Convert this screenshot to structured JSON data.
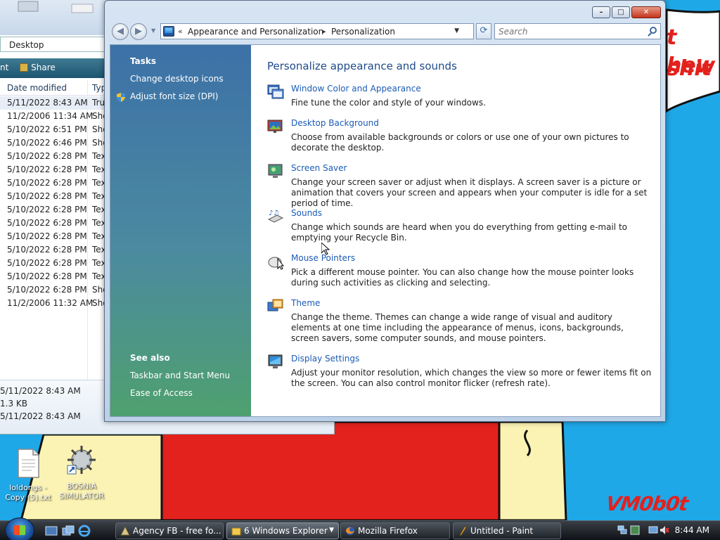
{
  "desktop": {
    "icons": [
      {
        "label": "loldongs - Copy (5).txt",
        "name": "text-file-icon"
      },
      {
        "label": "BOSNIA SIMULATOR",
        "name": "bosnia-simulator-icon"
      }
    ],
    "paint_text_line1": "t shit",
    "paint_text_line2": "hew",
    "watermark": "VM0b0t"
  },
  "explorer_back": {
    "address": "Desktop",
    "toolbar_left": "nt",
    "toolbar_share": "Share",
    "col_date": "Date modified",
    "col_type": "Typ",
    "rows": [
      {
        "date": "5/11/2022 8:43 AM",
        "type": "Tru"
      },
      {
        "date": "11/2/2006 11:34 AM",
        "type": "Sho"
      },
      {
        "date": "5/10/2022 6:51 PM",
        "type": "Sho"
      },
      {
        "date": "5/10/2022 6:46 PM",
        "type": "Sho"
      },
      {
        "date": "5/10/2022 6:28 PM",
        "type": "Tex"
      },
      {
        "date": "5/10/2022 6:28 PM",
        "type": "Tex"
      },
      {
        "date": "5/10/2022 6:28 PM",
        "type": "Tex"
      },
      {
        "date": "5/10/2022 6:28 PM",
        "type": "Tex"
      },
      {
        "date": "5/10/2022 6:28 PM",
        "type": "Tex"
      },
      {
        "date": "5/10/2022 6:28 PM",
        "type": "Tex"
      },
      {
        "date": "5/10/2022 6:28 PM",
        "type": "Tex"
      },
      {
        "date": "5/10/2022 6:28 PM",
        "type": "Tex"
      },
      {
        "date": "5/10/2022 6:28 PM",
        "type": "Tex"
      },
      {
        "date": "5/10/2022 6:28 PM",
        "type": "Tex"
      },
      {
        "date": "5/10/2022 6:28 PM",
        "type": "Sho"
      },
      {
        "date": "11/2/2006 11:32 AM",
        "type": "Sho"
      }
    ],
    "details": [
      "5/11/2022 8:43 AM",
      "1.3 KB",
      "5/11/2022 8:43 AM"
    ]
  },
  "window": {
    "breadcrumb": [
      "Appearance and Personalization",
      "Personalization"
    ],
    "search_placeholder": "Search",
    "controls": {
      "minimize": "–",
      "maximize": "□",
      "close": "✕"
    },
    "sidebar": {
      "tasks_heading": "Tasks",
      "tasks": [
        "Change desktop icons",
        "Adjust font size (DPI)"
      ],
      "see_also_heading": "See also",
      "see_also": [
        "Taskbar and Start Menu",
        "Ease of Access"
      ]
    },
    "content": {
      "title": "Personalize appearance and sounds",
      "items": [
        {
          "link": "Window Color and Appearance",
          "desc": "Fine tune the color and style of your windows.",
          "icon": "window-color-icon"
        },
        {
          "link": "Desktop Background",
          "desc": "Choose from available backgrounds or colors or use one of your own pictures to decorate the desktop.",
          "icon": "desktop-background-icon"
        },
        {
          "link": "Screen Saver",
          "desc": "Change your screen saver or adjust when it displays. A screen saver is a picture or animation that covers your screen and appears when your computer is idle for a set period of time.",
          "icon": "screen-saver-icon"
        },
        {
          "link": "Sounds",
          "desc": "Change which sounds are heard when you do everything from getting e-mail to emptying your Recycle Bin.",
          "icon": "sounds-icon"
        },
        {
          "link": "Mouse Pointers",
          "desc": "Pick a different mouse pointer. You can also change how the mouse pointer looks during such activities as clicking and selecting.",
          "icon": "mouse-icon"
        },
        {
          "link": "Theme",
          "desc": "Change the theme. Themes can change a wide range of visual and auditory elements at one time including the appearance of menus, icons, backgrounds, screen savers, some computer sounds, and mouse pointers.",
          "icon": "theme-icon"
        },
        {
          "link": "Display Settings",
          "desc": "Adjust your monitor resolution, which changes the view so more or fewer items fit on the screen. You can also control monitor flicker (refresh rate).",
          "icon": "display-settings-icon"
        }
      ]
    }
  },
  "taskbar": {
    "buttons": [
      {
        "label": "Agency FB - free fo...",
        "icon": "font-icon"
      },
      {
        "label": "6 Windows Explorer",
        "icon": "folder-icon"
      },
      {
        "label": "Mozilla Firefox",
        "icon": "firefox-icon"
      },
      {
        "label": "Untitled - Paint",
        "icon": "paint-icon"
      }
    ],
    "clock": "8:44 AM"
  },
  "colors": {
    "link": "#1b5bb6",
    "title": "#1e4a8a",
    "desktop": "#1fa8e8",
    "paint_red": "#e3211d",
    "paint_yellow": "#fbf3b3"
  }
}
